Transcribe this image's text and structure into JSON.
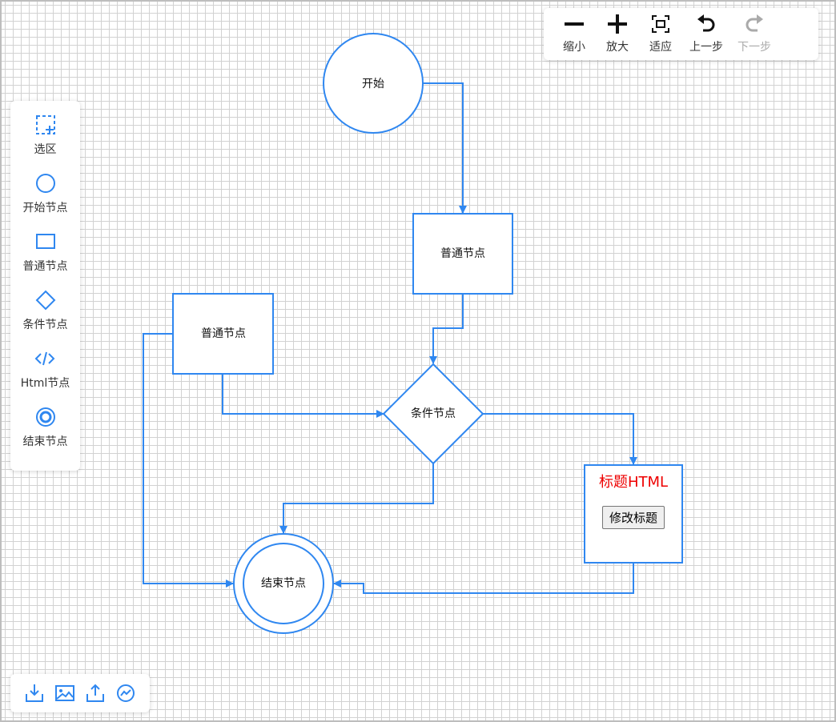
{
  "colors": {
    "accent": "#2f87f0",
    "html_title": "#ee0000",
    "disabled": "#aaaaaa"
  },
  "toolbar": {
    "zoom_out": "缩小",
    "zoom_in": "放大",
    "fit": "适应",
    "undo": "上一步",
    "redo": "下一步"
  },
  "sidebar": {
    "items": [
      {
        "label": "选区",
        "icon": "selection-icon"
      },
      {
        "label": "开始节点",
        "icon": "circle-icon"
      },
      {
        "label": "普通节点",
        "icon": "rect-icon"
      },
      {
        "label": "条件节点",
        "icon": "diamond-icon"
      },
      {
        "label": "Html节点",
        "icon": "code-icon"
      },
      {
        "label": "结束节点",
        "icon": "double-circle-icon"
      }
    ]
  },
  "bottom_tools": [
    {
      "icon": "download-icon"
    },
    {
      "icon": "image-icon"
    },
    {
      "icon": "upload-icon"
    },
    {
      "icon": "minimap-icon"
    }
  ],
  "nodes": {
    "start": "开始",
    "normal_1": "普通节点",
    "normal_2": "普通节点",
    "condition": "条件节点",
    "end": "结束节点",
    "html": {
      "title": "标题HTML",
      "button": "修改标题"
    }
  }
}
